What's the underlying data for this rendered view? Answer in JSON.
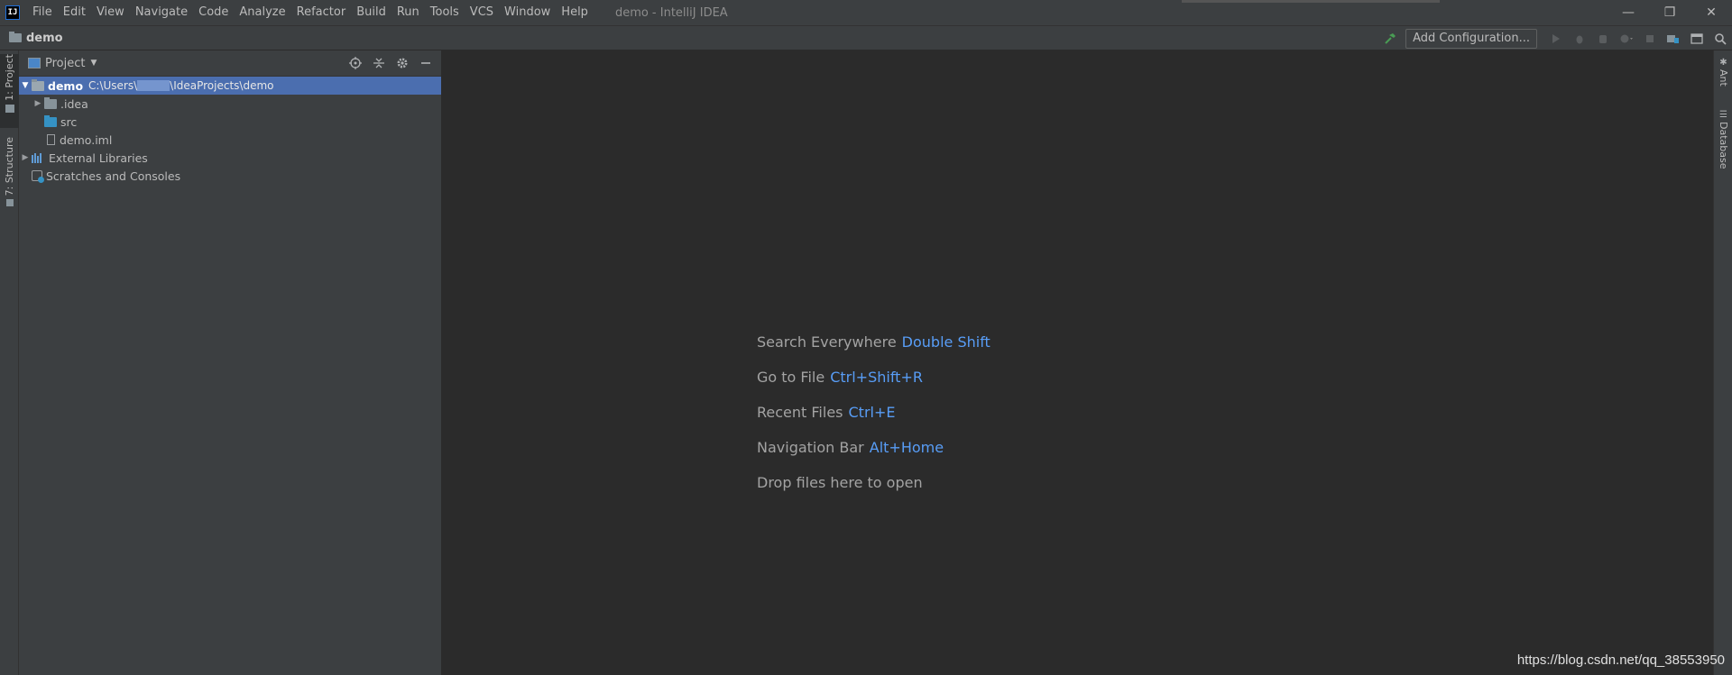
{
  "app": {
    "logo_text": "IJ",
    "window_title": "demo - IntelliJ IDEA"
  },
  "menu": [
    "File",
    "Edit",
    "View",
    "Navigate",
    "Code",
    "Analyze",
    "Refactor",
    "Build",
    "Run",
    "Tools",
    "VCS",
    "Window",
    "Help"
  ],
  "window_controls": {
    "minimize": "—",
    "restore": "❐",
    "close": "✕"
  },
  "navbar": {
    "project": "demo",
    "add_configuration": "Add Configuration..."
  },
  "left_strip": {
    "project_tab": "1: Project",
    "structure_tab": "7: Structure"
  },
  "project_panel": {
    "title": "Project",
    "tree": [
      {
        "name": "demo",
        "path_prefix": "C:\\Users\\",
        "path_suffix": "\\IdeaProjects\\demo"
      },
      {
        "name": ".idea"
      },
      {
        "name": "src"
      },
      {
        "name": "demo.iml"
      },
      {
        "name": "External Libraries"
      },
      {
        "name": "Scratches and Consoles"
      }
    ]
  },
  "editor_hints": [
    {
      "label": "Search Everywhere",
      "key": "Double Shift"
    },
    {
      "label": "Go to File",
      "key": "Ctrl+Shift+R"
    },
    {
      "label": "Recent Files",
      "key": "Ctrl+E"
    },
    {
      "label": "Navigation Bar",
      "key": "Alt+Home"
    },
    {
      "label": "Drop files here to open",
      "key": ""
    }
  ],
  "right_strip": {
    "ant_tab": "Ant",
    "database_tab": "Database"
  },
  "watermark": "https://blog.csdn.net/qq_38553950",
  "colors": {
    "accent": "#4b6eaf",
    "shortcut": "#589df6",
    "build": "#499c54"
  }
}
